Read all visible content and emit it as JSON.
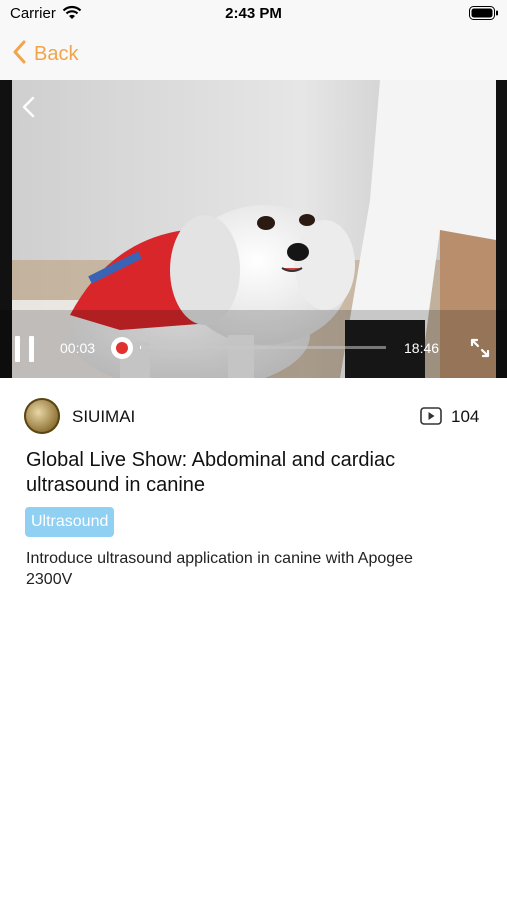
{
  "status_bar": {
    "carrier": "Carrier",
    "time": "2:43 PM"
  },
  "nav": {
    "back_label": "Back",
    "accent_color": "#f0a54a"
  },
  "video": {
    "current_time": "00:03",
    "total_time": "18:46",
    "progress": 0.003
  },
  "info": {
    "channel": "SIUIMAI",
    "views": "104",
    "title": "Global Live Show: Abdominal and cardiac ultrasound in canine",
    "tag": "Ultrasound",
    "tag_color": "#8fd0f3",
    "description": "Introduce ultrasound application in canine with Apogee 2300V"
  },
  "icons": [
    "wifi-icon",
    "battery-icon",
    "chevron-left-icon",
    "pause-icon",
    "record-icon",
    "fullscreen-icon",
    "play-icon"
  ]
}
